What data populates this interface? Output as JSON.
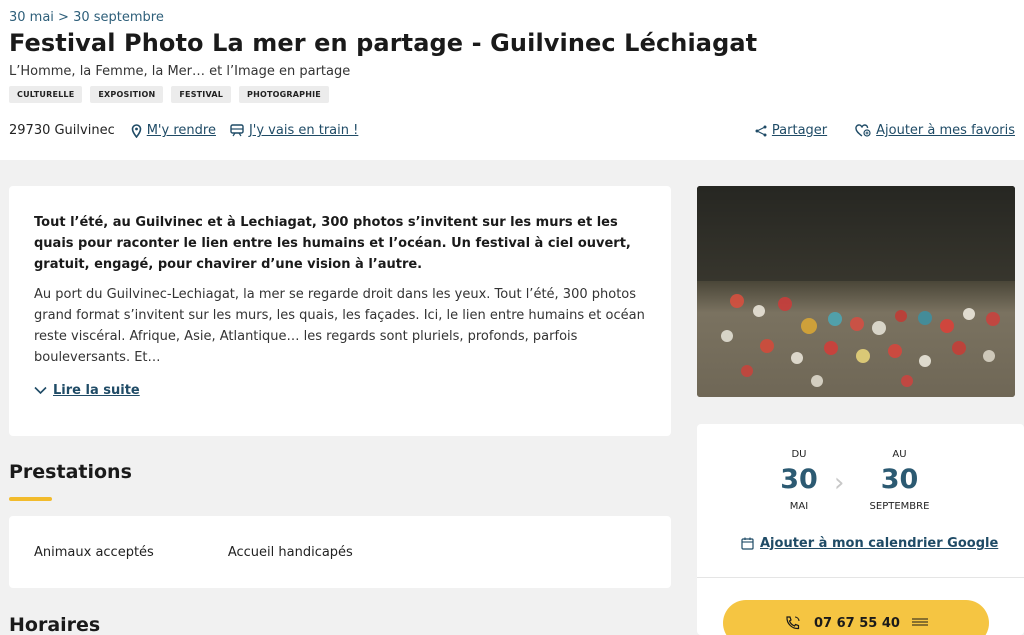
{
  "header": {
    "date_range": "30 mai > 30 septembre",
    "title": "Festival Photo La mer en partage - Guilvinec Léchiagat",
    "subtitle": "L’Homme, la Femme, la Mer… et l’Image en partage",
    "tags": [
      "CULTURELLE",
      "EXPOSITION",
      "FESTIVAL",
      "PHOTOGRAPHIE"
    ]
  },
  "location": {
    "city": "29730 Guilvinec",
    "directions_label": "M'y rendre",
    "train_label": "J'y vais en train !"
  },
  "actions": {
    "share_label": "Partager",
    "favorite_label": "Ajouter à mes favoris"
  },
  "description": {
    "lead": "Tout l’été, au Guilvinec et à Lechiagat, 300 photos s’invitent sur les murs et les quais pour raconter le lien entre les humains et l’océan. Un festival à ciel ouvert, gratuit, engagé, pour chavirer d’une vision à l’autre.",
    "body": "Au port du Guilvinec-Lechiagat, la mer se regarde droit dans les yeux. Tout l’été, 300 photos grand format s’invitent sur les murs, les quais, les façades. Ici, le lien entre humains et océan reste viscéral. Afrique, Asie, Atlantique… les regards sont pluriels, profonds, parfois bouleversants. Et…",
    "read_more": "Lire la suite"
  },
  "services": {
    "title": "Prestations",
    "items": [
      "Animaux acceptés",
      "Accueil handicapés"
    ]
  },
  "hours": {
    "title": "Horaires"
  },
  "dates": {
    "from_label": "DU",
    "from_day": "30",
    "from_month": "MAI",
    "to_label": "AU",
    "to_day": "30",
    "to_month": "SEPTEMBRE",
    "calendar_label": "Ajouter à mon calendrier Google"
  },
  "contact": {
    "phone": "07 67 55 40"
  },
  "colors": {
    "accent": "#f5c542",
    "link": "#1f4b66",
    "date_number": "#2c5a72"
  }
}
